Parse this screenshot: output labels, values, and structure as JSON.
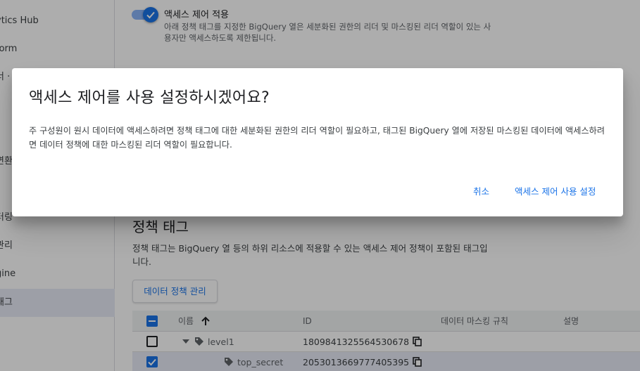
{
  "sidebar": {
    "items": [
      {
        "label": "ytics Hub",
        "active": false
      },
      {
        "label": "form",
        "active": false
      },
      {
        "label": "너 ·",
        "active": false
      },
      {
        "label": "변환",
        "active": false
      },
      {
        "label": "터링",
        "active": false
      },
      {
        "label": "관리",
        "active": false
      },
      {
        "label": "gine",
        "active": false
      },
      {
        "label": "태그",
        "active": true
      }
    ]
  },
  "access_control": {
    "title": "액세스 제어 적용",
    "description": "아래 정책 태그를 지정한 BigQuery 열은 세분화된 권한의 리더 및 마스킹된 리더 역할이 있는 사용자만 액세스하도록 제한됩니다.",
    "enabled": true
  },
  "policy": {
    "title": "정책 태그",
    "description": "정책 태그는 BigQuery 열 등의 하위 리소스에 적용할 수 있는 액세스 제어 정책이 포함된 태그입니다.",
    "manage_button": "데이터 정책 관리"
  },
  "table": {
    "headers": {
      "name": "이름",
      "id": "ID",
      "masking": "데이터 마스킹 규칙",
      "description": "설명"
    },
    "rows": [
      {
        "name": "level1",
        "id": "1809841325564530678",
        "checked": false
      },
      {
        "name": "top_secret",
        "id": "2053013669777405395",
        "checked": true
      }
    ]
  },
  "dialog": {
    "title": "액세스 제어를 사용 설정하시겠어요?",
    "body": "주 구성원이 원시 데이터에 액세스하려면 정책 태그에 대한 세분화된 권한의 리더 역할이 필요하고, 태그된 BigQuery 열에 저장된 마스킹된 데이터에 액세스하려면 데이터 정책에 대한 마스킹된 리더 역할이 필요합니다.",
    "cancel_label": "취소",
    "confirm_label": "액세스 제어 사용 설정"
  },
  "colors": {
    "accent": "#1a73e8",
    "scrim": "rgba(0,0,0,0.32)"
  }
}
